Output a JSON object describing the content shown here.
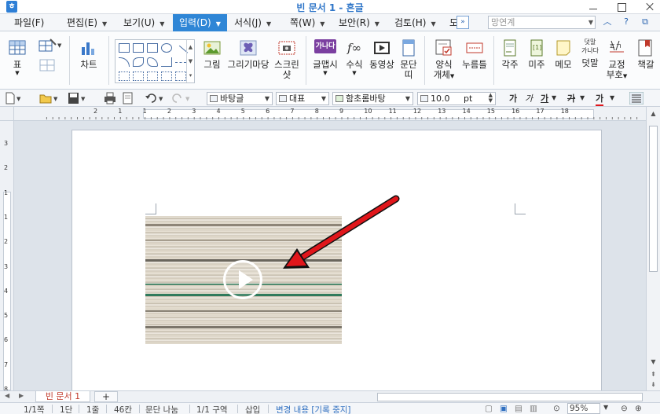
{
  "window": {
    "title": "빈 문서 1 - 흔글",
    "app_icon": "ㅎ"
  },
  "menu": {
    "items": [
      {
        "label": "파일(F)",
        "arrow": false
      },
      {
        "label": "편집(E)",
        "arrow": true
      },
      {
        "label": "보기(U)",
        "arrow": true
      },
      {
        "label": "입력(D)",
        "arrow": true,
        "active": true
      },
      {
        "label": "서식(J)",
        "arrow": true
      },
      {
        "label": "쪽(W)",
        "arrow": true
      },
      {
        "label": "보안(R)",
        "arrow": true
      },
      {
        "label": "검토(H)",
        "arrow": true
      },
      {
        "label": "도",
        "arrow": false
      }
    ],
    "expand_glyph": "»",
    "search_placeholder": "망연계"
  },
  "ribbon": {
    "buttons": {
      "table": "표",
      "chart": "차트",
      "picture": "그림",
      "drawing": "그리기마당",
      "screenshot_line1": "스크린",
      "screenshot_line2": "샷",
      "wordart": "글맵시",
      "equation": "수식",
      "video": "동영상",
      "char_line1": "문단",
      "char_line2": "띠",
      "form_line1": "양식",
      "form_line2": "개체",
      "pushbutton": "누름틀",
      "footnote": "각주",
      "endnote": "미주",
      "memo": "메모",
      "comment": "덧말",
      "bookmark_line1": "교정",
      "bookmark_line2": "부호",
      "bookmark2": "책갈",
      "comment_icon_top": "덧말",
      "comment_icon_bottom": "가나다",
      "wordart_icon": "가나다",
      "equation_icon": "f∞"
    }
  },
  "toolbar": {
    "style": "바탕글",
    "paragraph_style": "대표",
    "font": "함초롬바탕",
    "font_size": "10.0",
    "font_unit": "pt",
    "format_bold": "가",
    "format_italic": "가",
    "format_underline": "가",
    "format_strike": "가",
    "format_color": "가"
  },
  "ruler": {
    "h_labels": [
      "2",
      "1",
      "1",
      "2",
      "3",
      "4",
      "5",
      "6",
      "7",
      "8",
      "9",
      "10",
      "11",
      "12",
      "13",
      "14",
      "15",
      "16",
      "17",
      "18"
    ],
    "v_labels": [
      "3",
      "2",
      "1",
      "1",
      "2",
      "3",
      "4",
      "5",
      "6",
      "7",
      "8"
    ]
  },
  "document": {
    "video_icon": "play-icon",
    "arrow_color": "#e0161b"
  },
  "tabbar": {
    "doc_tab": "빈 문서 1",
    "add_tab": "+"
  },
  "status": {
    "page": "1/1쪽",
    "column": "1단",
    "line": "1줄",
    "char": "46칸",
    "para": "문단 나눔",
    "section": "1/1 구역",
    "mode": "삽입",
    "track": "변경 내용 [기록 중지]",
    "zoom": "95%"
  }
}
